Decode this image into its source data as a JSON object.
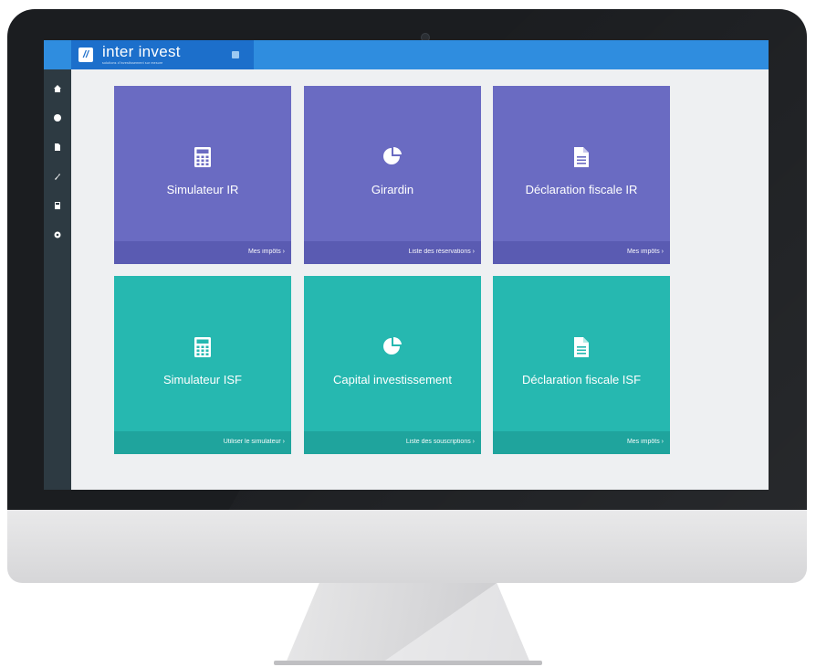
{
  "brand": {
    "logo_mark": "//",
    "name": "inter invest",
    "tagline": "solutions d'investissement sur mesure"
  },
  "sidebar": {
    "items": [
      {
        "icon": "home-icon"
      },
      {
        "icon": "user-icon"
      },
      {
        "icon": "document-icon"
      },
      {
        "icon": "tools-icon"
      },
      {
        "icon": "calculator-icon"
      },
      {
        "icon": "settings-icon"
      }
    ]
  },
  "colors": {
    "topbar": "#2f8ddf",
    "brand": "#1c6fcb",
    "sidebar": "#2d3a42",
    "tile_purple": "#6a6bc2",
    "tile_teal": "#26b8b0"
  },
  "tiles": [
    {
      "icon": "calculator-icon",
      "title": "Simulateur IR",
      "link": "Mes impôts ›"
    },
    {
      "icon": "pie-chart-icon",
      "title": "Girardin",
      "link": "Liste des réservations ›"
    },
    {
      "icon": "document-icon",
      "title": "Déclaration fiscale IR",
      "link": "Mes impôts ›"
    },
    {
      "icon": "calculator-icon",
      "title": "Simulateur ISF",
      "link": "Utiliser le simulateur ›"
    },
    {
      "icon": "pie-chart-icon",
      "title": "Capital investissement",
      "link": "Liste des souscriptions ›"
    },
    {
      "icon": "document-icon",
      "title": "Déclaration fiscale ISF",
      "link": "Mes impôts ›"
    }
  ]
}
